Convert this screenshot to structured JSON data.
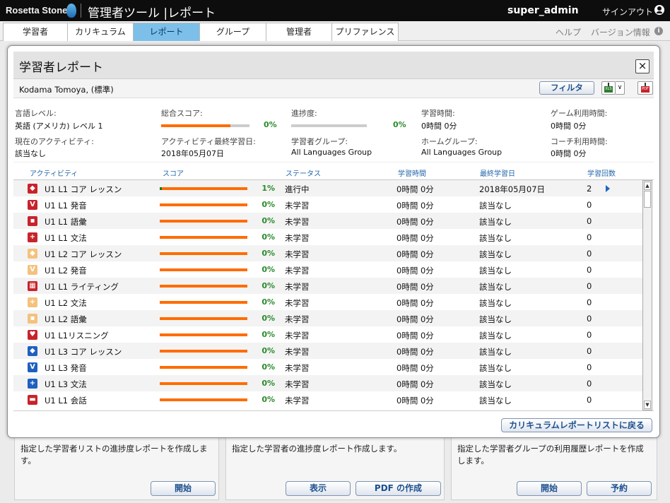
{
  "app": {
    "logo_text": "Rosetta Stone",
    "title": "管理者ツール |レポート",
    "user": "super_admin",
    "signout": "サインアウト"
  },
  "nav": {
    "tabs": [
      "学習者",
      "カリキュラム",
      "レポート",
      "グループ",
      "管理者",
      "プリファレンス"
    ],
    "active_tab": "レポート",
    "help": "ヘルプ",
    "version_info": "バージョン情報"
  },
  "background_cards": [
    {
      "text": "指定した学習者リストの進捗度レポートを作成します。",
      "buttons": [
        "開始"
      ]
    },
    {
      "text": "指定した学習者の進捗度レポート作成します。",
      "buttons": [
        "表示",
        "PDF の作成"
      ]
    },
    {
      "text": "指定した学習者グループの利用履歴レポートを作成します。",
      "buttons": [
        "開始",
        "予約"
      ]
    }
  ],
  "modal": {
    "title": "学習者レポート",
    "close": "×",
    "learner": "Kodama Tomoya, (標準)",
    "filter_label": "フィルタ",
    "xls_label": "XLS",
    "pdf_label": "PDF",
    "summary": {
      "language_level_label": "言語レベル:",
      "language_level": "英語 (アメリカ) レベル 1",
      "total_score_label": "総合スコア:",
      "total_score": "0%",
      "total_score_fraction": 0.78,
      "progress_label": "進捗度:",
      "progress": "0%",
      "progress_fraction": 0,
      "study_time_label": "学習時間:",
      "study_time": "0時間 0分",
      "game_time_label": "ゲーム利用時間:",
      "game_time": "0時間 0分",
      "current_activity_label": "現在のアクティビティ:",
      "current_activity": "該当なし",
      "last_activity_date_label": "アクティビティ最終学習日:",
      "last_activity_date": "2018年05月07日",
      "learner_group_label": "学習者グループ:",
      "learner_group": "All Languages Group",
      "home_group_label": "ホームグループ:",
      "home_group": "All Languages Group",
      "coach_time_label": "コーチ利用時間:",
      "coach_time": "0時間 0分"
    },
    "table": {
      "headers": [
        "アクティビティ",
        "スコア",
        "ステータス",
        "学習時間",
        "最終学習日",
        "学習回数"
      ],
      "rows": [
        {
          "name": "U1 L1 コア レッスン",
          "score": "1%",
          "status": "進行中",
          "time": "0時間 0分",
          "date": "2018年05月07日",
          "count": "2",
          "icon": "core-lesson-icon",
          "color": "#c8232a",
          "glyph": "◆"
        },
        {
          "name": "U1 L1 発音",
          "score": "0%",
          "status": "未学習",
          "time": "0時間 0分",
          "date": "該当なし",
          "count": "0",
          "icon": "pronunciation-icon",
          "color": "#c8232a",
          "glyph": "V"
        },
        {
          "name": "U1 L1 語彙",
          "score": "0%",
          "status": "未学習",
          "time": "0時間 0分",
          "date": "該当なし",
          "count": "0",
          "icon": "vocabulary-icon",
          "color": "#c8232a",
          "glyph": "▪"
        },
        {
          "name": "U1 L1 文法",
          "score": "0%",
          "status": "未学習",
          "time": "0時間 0分",
          "date": "該当なし",
          "count": "0",
          "icon": "grammar-icon",
          "color": "#c8232a",
          "glyph": "+"
        },
        {
          "name": "U1 L2 コア レッスン",
          "score": "0%",
          "status": "未学習",
          "time": "0時間 0分",
          "date": "該当なし",
          "count": "0",
          "icon": "core-lesson-icon",
          "color": "#f3c27d",
          "glyph": "◆"
        },
        {
          "name": "U1 L2 発音",
          "score": "0%",
          "status": "未学習",
          "time": "0時間 0分",
          "date": "該当なし",
          "count": "0",
          "icon": "pronunciation-icon",
          "color": "#f3c27d",
          "glyph": "V"
        },
        {
          "name": "U1 L1 ライティング",
          "score": "0%",
          "status": "未学習",
          "time": "0時間 0分",
          "date": "該当なし",
          "count": "0",
          "icon": "writing-icon",
          "color": "#c8232a",
          "glyph": "▦"
        },
        {
          "name": "U1 L2 文法",
          "score": "0%",
          "status": "未学習",
          "time": "0時間 0分",
          "date": "該当なし",
          "count": "0",
          "icon": "grammar-icon",
          "color": "#f3c27d",
          "glyph": "+"
        },
        {
          "name": "U1 L2 語彙",
          "score": "0%",
          "status": "未学習",
          "time": "0時間 0分",
          "date": "該当なし",
          "count": "0",
          "icon": "vocabulary-icon",
          "color": "#f3c27d",
          "glyph": "▪"
        },
        {
          "name": "U1 L1リスニング",
          "score": "0%",
          "status": "未学習",
          "time": "0時間 0分",
          "date": "該当なし",
          "count": "0",
          "icon": "listening-icon",
          "color": "#c8232a",
          "glyph": "♥"
        },
        {
          "name": "U1 L3 コア レッスン",
          "score": "0%",
          "status": "未学習",
          "time": "0時間 0分",
          "date": "該当なし",
          "count": "0",
          "icon": "core-lesson-icon",
          "color": "#1f5fbf",
          "glyph": "◆"
        },
        {
          "name": "U1 L3 発音",
          "score": "0%",
          "status": "未学習",
          "time": "0時間 0分",
          "date": "該当なし",
          "count": "0",
          "icon": "pronunciation-icon",
          "color": "#1f5fbf",
          "glyph": "V"
        },
        {
          "name": "U1 L3 文法",
          "score": "0%",
          "status": "未学習",
          "time": "0時間 0分",
          "date": "該当なし",
          "count": "0",
          "icon": "grammar-icon",
          "color": "#1f5fbf",
          "glyph": "+"
        },
        {
          "name": "U1 L1 会話",
          "score": "0%",
          "status": "未学習",
          "time": "0時間 0分",
          "date": "該当なし",
          "count": "0",
          "icon": "speaking-icon",
          "color": "#c8232a",
          "glyph": "▬"
        }
      ]
    },
    "back_label": "カリキュラムレポートリストに戻る"
  },
  "colors": {
    "accent": "#7cc0ea",
    "score_bar": "#ff6c00",
    "percent_text": "#2c8b2c",
    "link": "#2266aa"
  }
}
